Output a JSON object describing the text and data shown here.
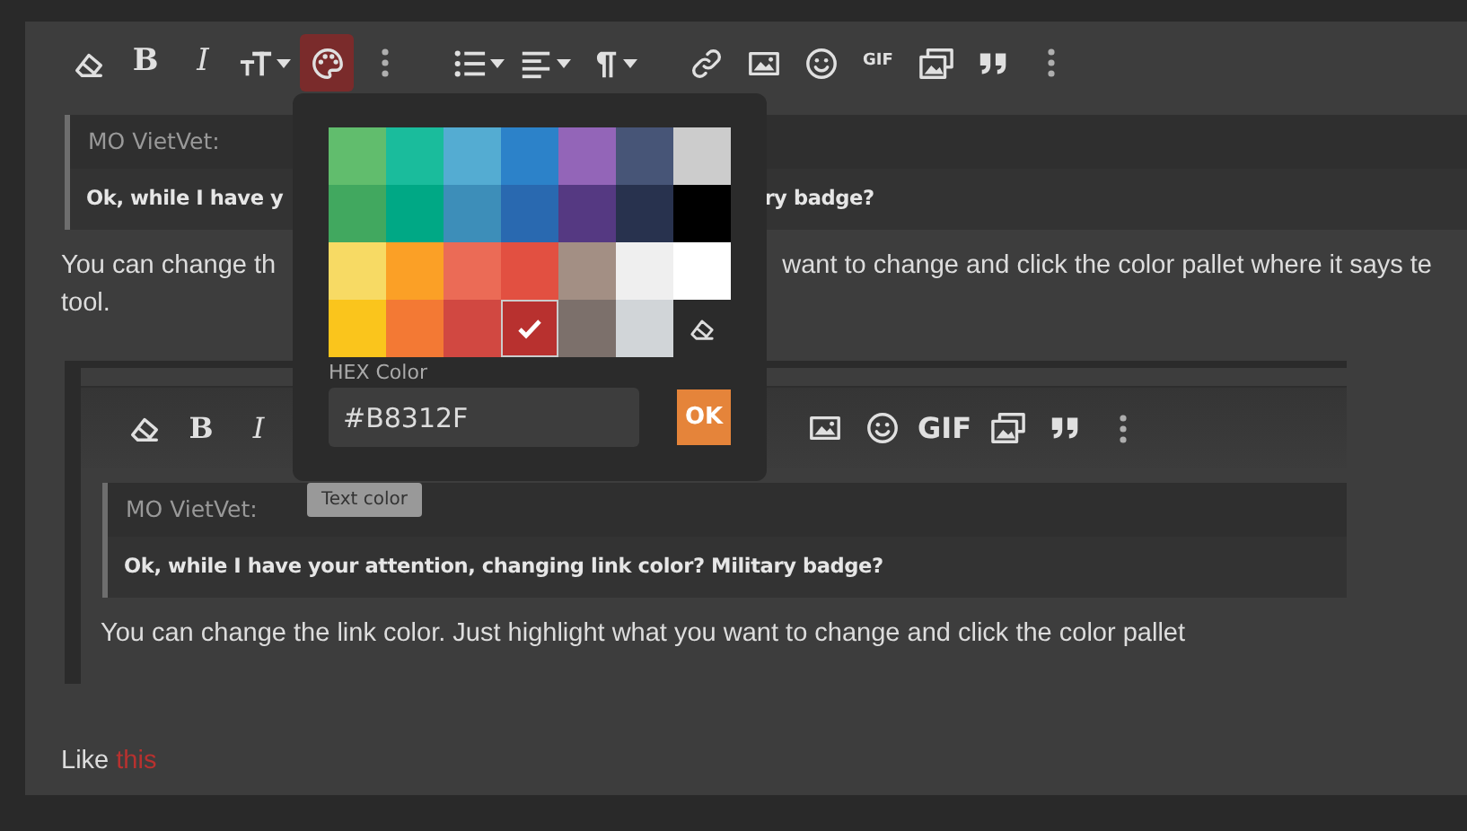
{
  "toolbar": {
    "items": [
      {
        "kind": "eraser",
        "active": false
      },
      {
        "kind": "bold",
        "label": "B",
        "active": false
      },
      {
        "kind": "italic",
        "label": "I",
        "active": false
      },
      {
        "kind": "text-size",
        "active": false
      },
      {
        "kind": "palette",
        "active": true
      },
      {
        "kind": "more",
        "active": false
      },
      {
        "kind": "list",
        "active": false
      },
      {
        "kind": "align",
        "active": false
      },
      {
        "kind": "paragraph",
        "active": false
      },
      {
        "kind": "link",
        "active": false
      },
      {
        "kind": "image",
        "active": false
      },
      {
        "kind": "smiley",
        "active": false
      },
      {
        "kind": "gif",
        "label": "GIF",
        "active": false
      },
      {
        "kind": "media",
        "active": false
      },
      {
        "kind": "quote",
        "active": false
      },
      {
        "kind": "more",
        "active": false
      }
    ]
  },
  "quote": {
    "author": "MO VietVet:",
    "text_before": "Ok, while I have y",
    "text_after": "ry badge?"
  },
  "paragraph": {
    "text_before": "You can change th",
    "text_after": "want to change and click the color pallet where it says te",
    "line_2": "tool."
  },
  "embedded_editor": {
    "toolbar_left": [
      {
        "kind": "eraser"
      },
      {
        "kind": "bold",
        "label": "B"
      },
      {
        "kind": "italic",
        "label": "I"
      }
    ],
    "toolbar_right": [
      {
        "kind": "image"
      },
      {
        "kind": "smiley"
      },
      {
        "kind": "gif",
        "label": "GIF"
      },
      {
        "kind": "media"
      },
      {
        "kind": "quote"
      },
      {
        "kind": "more"
      }
    ],
    "tooltip": "Text color",
    "quote": {
      "author": "MO VietVet:",
      "text": "Ok, while I have your attention, changing link color? Military badge?"
    },
    "paragraph": "You can change the link color. Just highlight what you want to change and click the color pallet"
  },
  "reply": {
    "text": "Like",
    "link": "this"
  },
  "color_picker": {
    "swatches": [
      {
        "color": "#61bd6d",
        "selected": false
      },
      {
        "color": "#1abc9c",
        "selected": false
      },
      {
        "color": "#54acd2",
        "selected": false
      },
      {
        "color": "#2c82c9",
        "selected": false
      },
      {
        "color": "#9365b8",
        "selected": false
      },
      {
        "color": "#475577",
        "selected": false
      },
      {
        "color": "#cccccc",
        "selected": false
      },
      {
        "color": "#41a85f",
        "selected": false
      },
      {
        "color": "#00a885",
        "selected": false
      },
      {
        "color": "#3d8eb9",
        "selected": false
      },
      {
        "color": "#2969b0",
        "selected": false
      },
      {
        "color": "#553982",
        "selected": false
      },
      {
        "color": "#28324e",
        "selected": false
      },
      {
        "color": "#000000",
        "selected": false
      },
      {
        "color": "#f7da64",
        "selected": false
      },
      {
        "color": "#fba026",
        "selected": false
      },
      {
        "color": "#eb6b56",
        "selected": false
      },
      {
        "color": "#e25041",
        "selected": false
      },
      {
        "color": "#a38f84",
        "selected": false
      },
      {
        "color": "#efefef",
        "selected": false
      },
      {
        "color": "#ffffff",
        "selected": false
      },
      {
        "color": "#fac51c",
        "selected": false
      },
      {
        "color": "#f37934",
        "selected": false
      },
      {
        "color": "#d14841",
        "selected": false
      },
      {
        "color": "#b8312f",
        "selected": true
      },
      {
        "color": "#7c706b",
        "selected": false
      },
      {
        "color": "#d1d5d8",
        "selected": false
      }
    ],
    "hex_label": "HEX Color",
    "hex_value": "#B8312F",
    "ok_button": "OK"
  }
}
